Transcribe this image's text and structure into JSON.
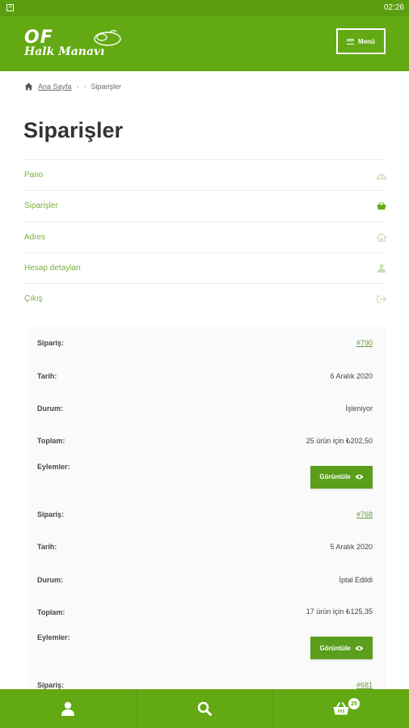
{
  "status_bar": {
    "time": "02:26",
    "notification_glyph": "A"
  },
  "header": {
    "logo_line1": "OF",
    "logo_line2": "Halk Manavı",
    "menu_label": "Menü"
  },
  "breadcrumb": {
    "home": "Ana Sayfa",
    "separator": "›",
    "current": "Siparişler"
  },
  "page_title": "Siparişler",
  "account_nav": [
    {
      "label": "Pano",
      "icon": "dashboard-icon"
    },
    {
      "label": "Siparişler",
      "icon": "basket-icon"
    },
    {
      "label": "Adres",
      "icon": "home-icon"
    },
    {
      "label": "Hesap detayları",
      "icon": "user-icon"
    },
    {
      "label": "Çıkış",
      "icon": "logout-icon"
    }
  ],
  "labels": {
    "order": "Sipariş:",
    "date": "Tarih:",
    "status": "Durum:",
    "total": "Toplam:",
    "actions": "Eylemler:",
    "view": "Görüntüle"
  },
  "orders": [
    {
      "number": "#790",
      "date": "6 Aralık 2020",
      "status": "İşleniyor",
      "total": "25 ürün için ₺202,50"
    },
    {
      "number": "#768",
      "date": "5 Aralık 2020",
      "status": "İptal Edildi",
      "total": "17 ürün için ₺125,35"
    },
    {
      "number": "#681"
    }
  ],
  "bottom_nav": {
    "cart_count": "25"
  },
  "colors": {
    "brand_green": "#63a913",
    "link_green": "#7aae3c",
    "button_green": "#5a9e1c"
  }
}
